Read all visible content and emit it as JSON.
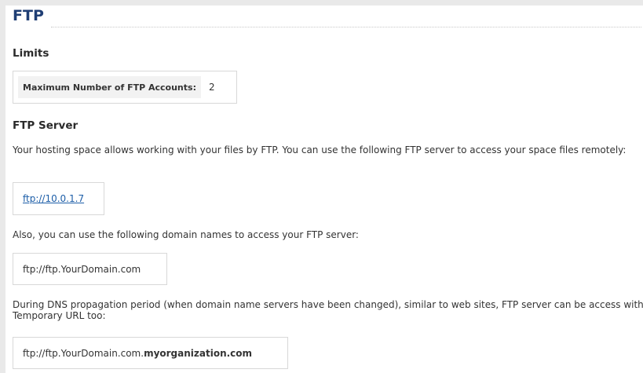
{
  "page": {
    "title": "FTP"
  },
  "limits": {
    "heading": "Limits",
    "max_accounts_label": "Maximum Number of FTP Accounts:",
    "max_accounts_value": "2"
  },
  "ftp_server": {
    "heading": "FTP Server",
    "description": "Your hosting space allows working with your files by FTP. You can use the following FTP server to access your space files remotely:",
    "server_url": "ftp://10.0.1.7",
    "domain_names_text": "Also, you can use the following domain names to access your FTP server:",
    "domain_url": "ftp://ftp.YourDomain.com",
    "dns_text": "During DNS propagation period (when domain name servers have been changed), similar to web sites, FTP server can be access with Temporary URL too:",
    "temp_url_prefix": "ftp://ftp.YourDomain.com.",
    "temp_url_suffix": "myorganization.com"
  },
  "colors": {
    "title": "#1f3e74",
    "link": "#1d5ea8",
    "background": "#e9e9e9",
    "panel": "#ffffff"
  }
}
